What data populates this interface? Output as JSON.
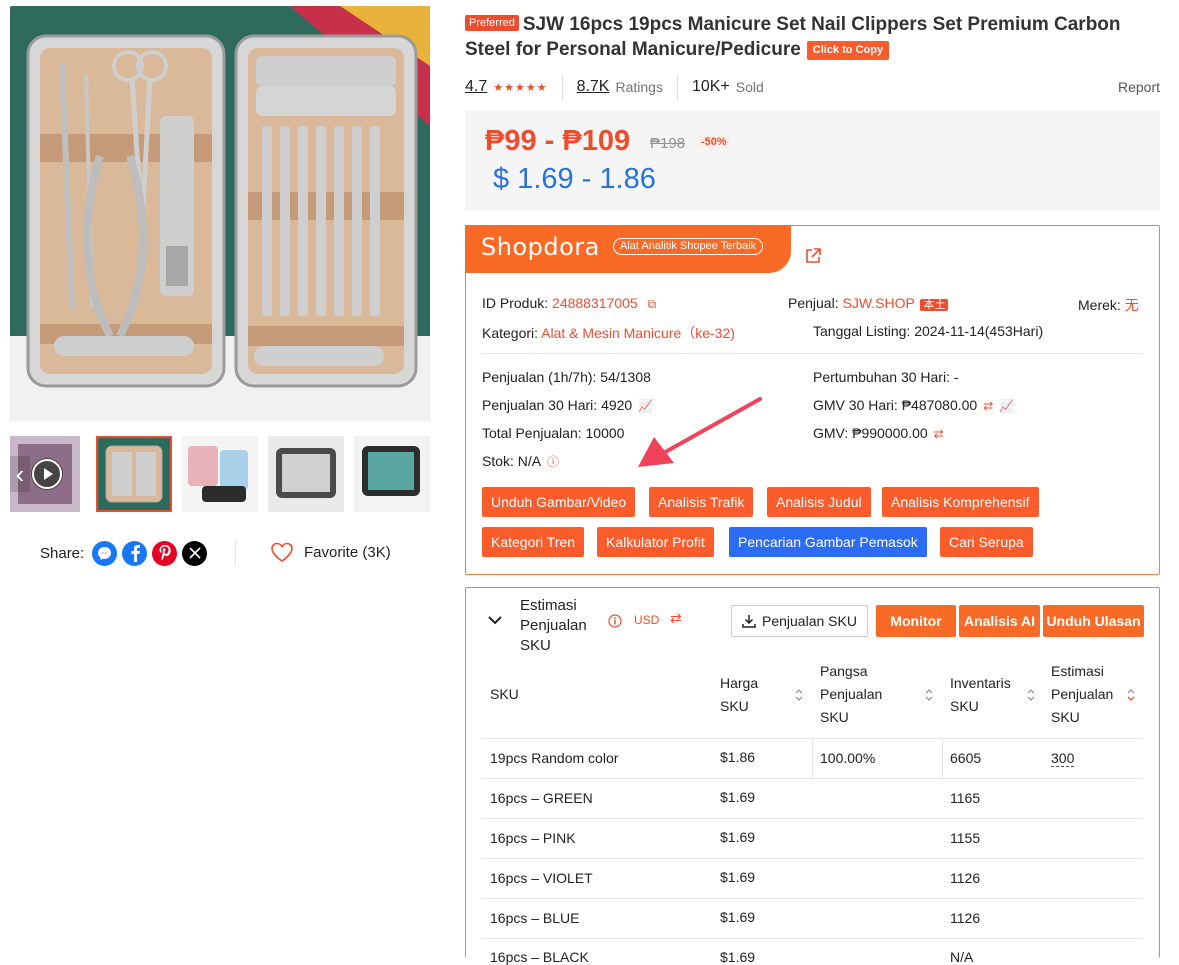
{
  "product": {
    "preferred_badge": "Preferred",
    "title": "SJW 16pcs 19pcs Manicure Set Nail Clippers Set Premium Carbon Steel for Personal Manicure/Pedicure",
    "copy_button": "Click to Copy",
    "rating": "4.7",
    "ratings_count": "8.7K",
    "ratings_label": "Ratings",
    "sold_count": "10K+",
    "sold_label": "Sold",
    "report_link": "Report",
    "price_range": "₱99 - ₱109",
    "price_original": "₱198",
    "discount": "-50%",
    "price_usd": "$ 1.69 - 1.86"
  },
  "gallery": {
    "thumbnails": [
      "thumb-1",
      "thumb-2",
      "thumb-3",
      "thumb-4",
      "thumb-5"
    ],
    "active_index": 1
  },
  "share": {
    "label": "Share:",
    "favorite": "Favorite (3K)",
    "icons": [
      "messenger-icon",
      "facebook-icon",
      "pinterest-icon",
      "x-icon"
    ]
  },
  "shopdora": {
    "brand": "Shopdora",
    "tagline": "Alat Analitik Shopee Terbaik",
    "product_id_label": "ID Produk:",
    "product_id": "24888317005",
    "seller_label": "Penjual:",
    "seller": "SJW.SHOP",
    "seller_tag": "本土",
    "brand_label": "Merek:",
    "brand_value": "无",
    "category_label": "Kategori:",
    "category": "Alat & Mesin Manicure（ke-32)",
    "listing_label": "Tanggal Listing:",
    "listing_value": "2024-11-14(453Hari)",
    "sales_1h7h": "Penjualan (1h/7h): 54/1308",
    "sales_30d": "Penjualan 30 Hari: 4920",
    "total_sales": "Total Penjualan: 10000",
    "stock": "Stok: N/A",
    "growth_30d": "Pertumbuhan 30 Hari: -",
    "gmv_30d": "GMV 30 Hari: ₱487080.00",
    "gmv": "GMV: ₱990000.00",
    "buttons": [
      "Unduh Gambar/Video",
      "Analisis Trafik",
      "Analisis Judul",
      "Analisis Komprehensif",
      "Kategori Tren",
      "Kalkulator Profit",
      "Pencarian Gambar Pemasok",
      "Cari Serupa"
    ]
  },
  "sku_panel": {
    "title": "Estimasi Penjualan SKU",
    "currency": "USD",
    "btn_sku_sales": "Penjualan SKU",
    "btn_monitor": "Monitor",
    "btn_ai": "Analisis AI",
    "btn_reviews": "Unduh Ulasan",
    "columns": [
      "SKU",
      "Harga SKU",
      "Pangsa Penjualan SKU",
      "Inventaris SKU",
      "Estimasi Penjualan SKU"
    ],
    "rows": [
      {
        "sku": "19pcs Random color",
        "price": "$1.86",
        "share": "100.00%",
        "inventory": "6605",
        "estimate": "300"
      },
      {
        "sku": "16pcs – GREEN",
        "price": "$1.69",
        "share": "",
        "inventory": "1165",
        "estimate": ""
      },
      {
        "sku": "16pcs – PINK",
        "price": "$1.69",
        "share": "",
        "inventory": "1155",
        "estimate": ""
      },
      {
        "sku": "16pcs – VIOLET",
        "price": "$1.69",
        "share": "",
        "inventory": "1126",
        "estimate": ""
      },
      {
        "sku": "16pcs – BLUE",
        "price": "$1.69",
        "share": "",
        "inventory": "1126",
        "estimate": ""
      },
      {
        "sku": "16pcs – BLACK",
        "price": "$1.69",
        "share": "",
        "inventory": "N/A",
        "estimate": ""
      }
    ]
  },
  "colors": {
    "accent": "#ee4d2d",
    "shopdora": "#fa6a27",
    "usd_blue": "#2673dd",
    "button_blue": "#2c6cf5"
  }
}
